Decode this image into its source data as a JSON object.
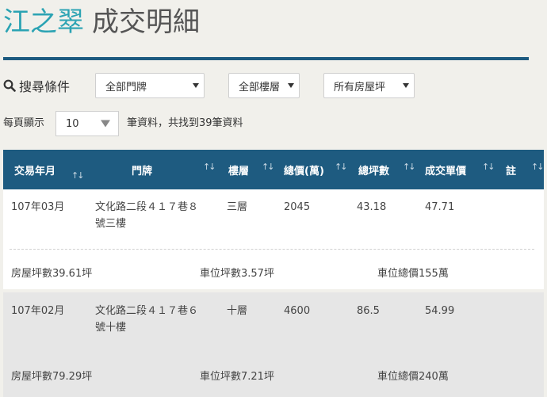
{
  "page": {
    "title_name": "江之翠",
    "title_sub": "成交明細"
  },
  "search": {
    "label": "搜尋條件",
    "filters": [
      {
        "name": "door-filter",
        "value": "全部門牌"
      },
      {
        "name": "floor-filter",
        "value": "全部樓層"
      },
      {
        "name": "house-size-filter",
        "value": "所有房屋坪"
      }
    ]
  },
  "paging": {
    "label": "每頁顯示",
    "per_page": "10",
    "result_text": "筆資料，共找到39筆資料"
  },
  "table": {
    "columns": [
      "交易年月",
      "門牌",
      "樓層",
      "總價(萬)",
      "總坪數",
      "成交單價",
      "註"
    ],
    "rows": [
      {
        "date": "107年03月",
        "address_line1": "文化路二段４１７巷８",
        "address_line2": "號三樓",
        "floor": "三層",
        "total_price": "2045",
        "total_area": "43.18",
        "unit_price": "47.71",
        "note": "",
        "house_area": "房屋坪數39.61坪",
        "parking_area": "車位坪數3.57坪",
        "parking_price": "車位總價155萬"
      },
      {
        "date": "107年02月",
        "address_line1": "文化路二段４１７巷６",
        "address_line2": "號十樓",
        "floor": "十層",
        "total_price": "4600",
        "total_area": "86.5",
        "unit_price": "54.99",
        "note": "",
        "house_area": "房屋坪數79.29坪",
        "parking_area": "車位坪數7.21坪",
        "parking_price": "車位總價240萬"
      }
    ]
  },
  "colors": {
    "accent": "#2ba3b3",
    "header_bg": "#1e5b80",
    "page_bg": "#f1f0eb"
  }
}
